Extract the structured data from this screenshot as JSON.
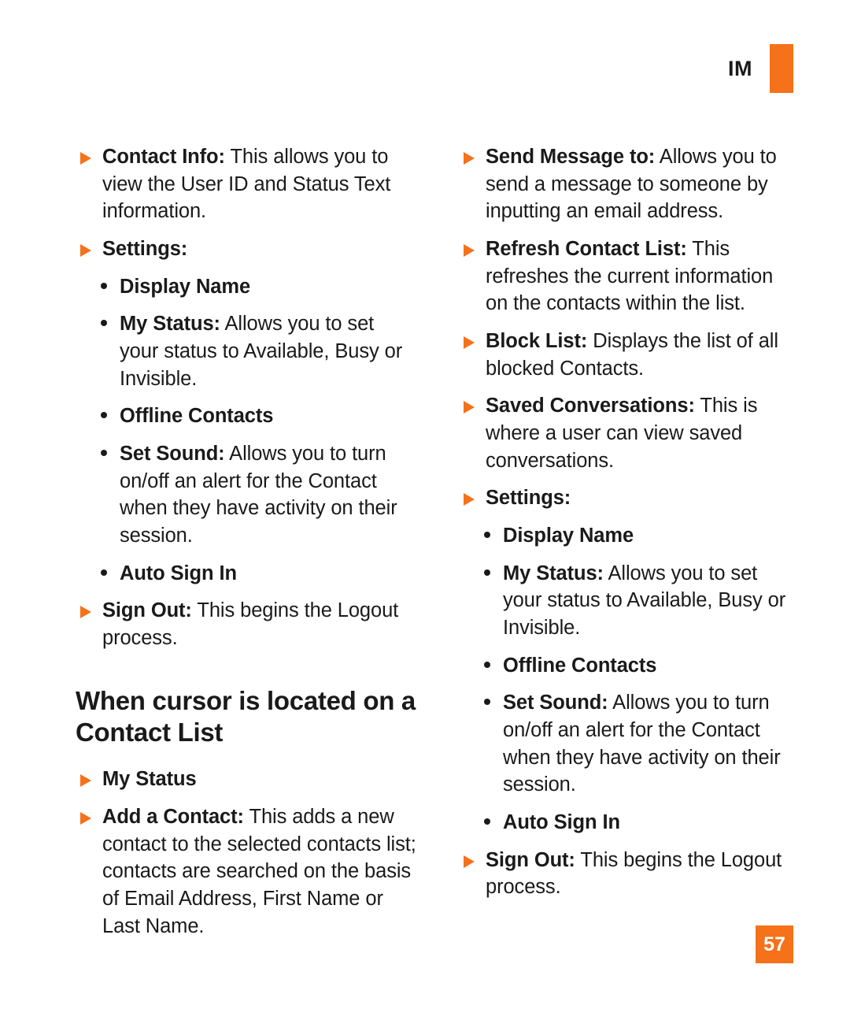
{
  "header": {
    "label": "IM",
    "tab_color": "#F5711A"
  },
  "accent_color": "#F5711A",
  "left_column": {
    "items": [
      {
        "level": 1,
        "term": "Contact Info:",
        "desc": " This allows you to view the User ID and Status Text information."
      },
      {
        "level": 1,
        "term": "Settings:",
        "desc": ""
      },
      {
        "level": 2,
        "term": "Display Name",
        "desc": ""
      },
      {
        "level": 2,
        "term": "My Status:",
        "desc": " Allows you to set your status to Available, Busy or Invisible."
      },
      {
        "level": 2,
        "term": "Offline Contacts",
        "desc": ""
      },
      {
        "level": 2,
        "term": "Set Sound:",
        "desc": " Allows you to turn on/off an alert for the Contact when they have activity on their session."
      },
      {
        "level": 2,
        "term": "Auto Sign In",
        "desc": ""
      },
      {
        "level": 1,
        "term": "Sign Out:",
        "desc": " This begins the Logout process."
      }
    ],
    "heading": "When cursor is located on a Contact List",
    "items_after_heading": [
      {
        "level": 1,
        "term": "My Status",
        "desc": ""
      },
      {
        "level": 1,
        "term": "Add a Contact:",
        "desc": " This adds a new contact to the selected contacts list; contacts are searched on the basis of Email Address, First Name or Last Name."
      }
    ]
  },
  "right_column": {
    "items": [
      {
        "level": 1,
        "term": "Send Message to:",
        "desc": " Allows you to send a message to someone by inputting an email address."
      },
      {
        "level": 1,
        "term": "Refresh Contact List:",
        "desc": " This refreshes the current information on the contacts within the list."
      },
      {
        "level": 1,
        "term": "Block List:",
        "desc": " Displays the list of all blocked Contacts."
      },
      {
        "level": 1,
        "term": "Saved Conversations:",
        "desc": " This is where a user can view saved conversations."
      },
      {
        "level": 1,
        "term": "Settings:",
        "desc": ""
      },
      {
        "level": 2,
        "term": "Display Name",
        "desc": ""
      },
      {
        "level": 2,
        "term": "My Status:",
        "desc": " Allows you to set your status to Available, Busy or Invisible."
      },
      {
        "level": 2,
        "term": "Offline Contacts",
        "desc": ""
      },
      {
        "level": 2,
        "term": "Set Sound:",
        "desc": " Allows you to turn on/off an alert for the Contact when they have activity on their session."
      },
      {
        "level": 2,
        "term": "Auto Sign In",
        "desc": ""
      },
      {
        "level": 1,
        "term": "Sign Out:",
        "desc": " This begins the Logout process."
      }
    ]
  },
  "footer": {
    "page_number": "57"
  }
}
